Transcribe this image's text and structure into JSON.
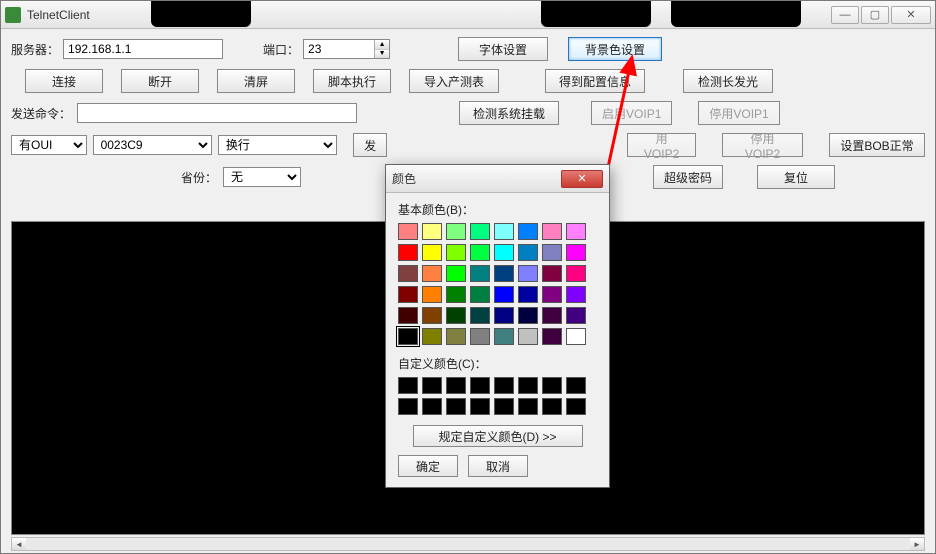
{
  "window": {
    "title": "TelnetClient",
    "min": "—",
    "restore": "▢",
    "close": "✕"
  },
  "row1": {
    "server_label": "服务器：",
    "server_value": "192.168.1.1",
    "port_label": "端口：",
    "port_value": "23",
    "font_btn": "字体设置",
    "bgcolor_btn": "背景色设置"
  },
  "row2": {
    "connect": "连接",
    "disconnect": "断开",
    "clear": "清屏",
    "script": "脚本执行",
    "import_test": "导入产测表",
    "get_cfg": "得到配置信息",
    "check_laser": "检测长发光"
  },
  "row3": {
    "send_label": "发送命令：",
    "send_value": "",
    "check_mount": "检测系统挂载",
    "enable_voip1": "启用VOIP1",
    "disable_voip1": "停用VOIP1"
  },
  "row4": {
    "oui_sel": "有OUI",
    "mac_value": "0023C9",
    "wrap_sel": "换行",
    "send_btn": "发",
    "enable_voip2": "用VOIP2",
    "disable_voip2": "停用VOIP2",
    "set_bob": "设置BOB正常"
  },
  "row5": {
    "prov_label": "省份：",
    "prov_sel": "无",
    "super_pwd": "超级密码",
    "reset": "复位"
  },
  "color_dialog": {
    "title": "颜色",
    "basic_label": "基本颜色(B)：",
    "custom_label": "自定义颜色(C)：",
    "define_btn": "规定自定义颜色(D) >>",
    "ok": "确定",
    "cancel": "取消",
    "basic_colors": [
      "#ff8080",
      "#ffff80",
      "#80ff80",
      "#00ff80",
      "#80ffff",
      "#0080ff",
      "#ff80c0",
      "#ff80ff",
      "#ff0000",
      "#ffff00",
      "#80ff00",
      "#00ff40",
      "#00ffff",
      "#0080c0",
      "#8080c0",
      "#ff00ff",
      "#804040",
      "#ff8040",
      "#00ff00",
      "#008080",
      "#004080",
      "#8080ff",
      "#800040",
      "#ff0080",
      "#800000",
      "#ff8000",
      "#008000",
      "#008040",
      "#0000ff",
      "#0000a0",
      "#800080",
      "#8000ff",
      "#400000",
      "#804000",
      "#004000",
      "#004040",
      "#000080",
      "#000040",
      "#400040",
      "#400080",
      "#000000",
      "#808000",
      "#808040",
      "#808080",
      "#408080",
      "#c0c0c0",
      "#400040",
      "#ffffff"
    ],
    "selected_index": 40
  },
  "chart_data": null
}
